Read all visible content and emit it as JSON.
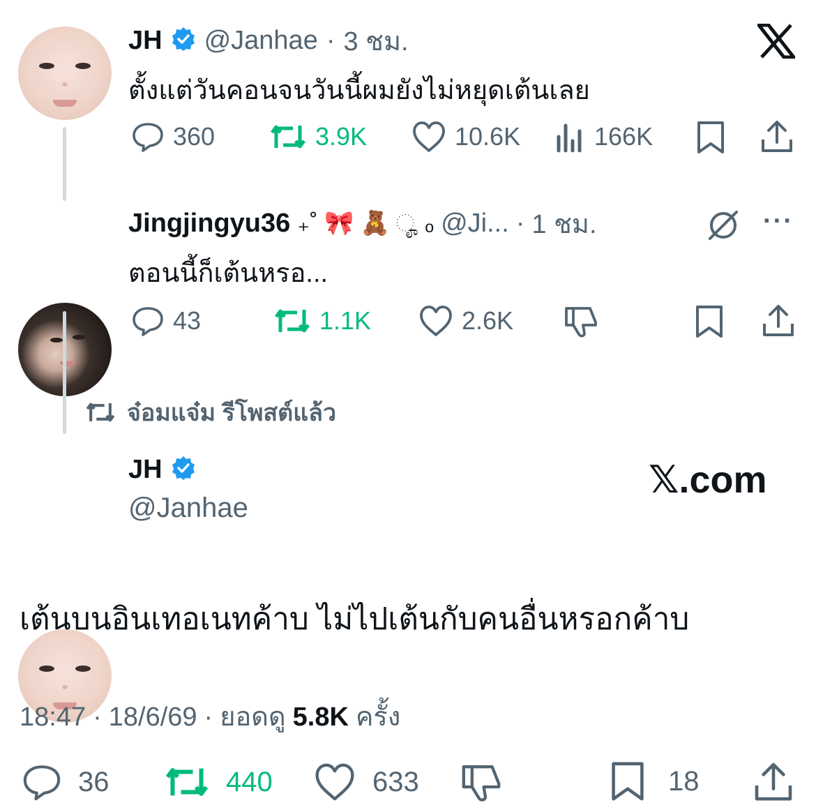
{
  "tweet1": {
    "name": "JH",
    "handle": "@Janhae",
    "sep": "·",
    "time": "3 ชม.",
    "text": "ตั้งแต่วันคอนจนวันนี้ผมยังไม่หยุดเต้นเลย",
    "replies": "360",
    "retweets": "3.9K",
    "likes": "10.6K",
    "views": "166K"
  },
  "tweet2": {
    "name": "Jingjingyu36",
    "decor": "₊˚ 🎀 🧸 ೄ ₒ",
    "handle": "@Ji...",
    "sep": "·",
    "time": "1 ชม.",
    "more": "···",
    "text": "ตอนนี้ก็เต้นหรอ...",
    "replies": "43",
    "retweets": "1.1K",
    "likes": "2.6K"
  },
  "repost_banner": {
    "text": "จ๋อมแจ๋ม รีโพสต์แล้ว"
  },
  "main_tweet": {
    "name": "JH",
    "handle": "@Janhae",
    "brand": "𝕏.com",
    "text": "เต้นบนอินเทอเนทค้าบ ไม่ไปเต้นกับคนอื่นหรอกค้าบ",
    "time": "18:47",
    "sep1": "·",
    "date": "18/6/69",
    "sep2": "·",
    "views_label": "ยอดดู",
    "views_count": "5.8K",
    "views_suffix": "ครั้ง",
    "replies": "36",
    "retweets": "440",
    "likes": "633",
    "bookmarks": "18"
  },
  "colors": {
    "verified": "#1d9bf0",
    "retweet_green": "#00ba7c",
    "muted": "#536471",
    "text": "#0f1419",
    "thread_line": "#cfd9de"
  },
  "icons": [
    "x-logo-icon",
    "verified-badge-icon",
    "reply-icon",
    "retweet-icon",
    "like-icon",
    "views-icon",
    "bookmark-icon",
    "share-icon",
    "grok-icon",
    "more-icon",
    "dislike-icon"
  ]
}
